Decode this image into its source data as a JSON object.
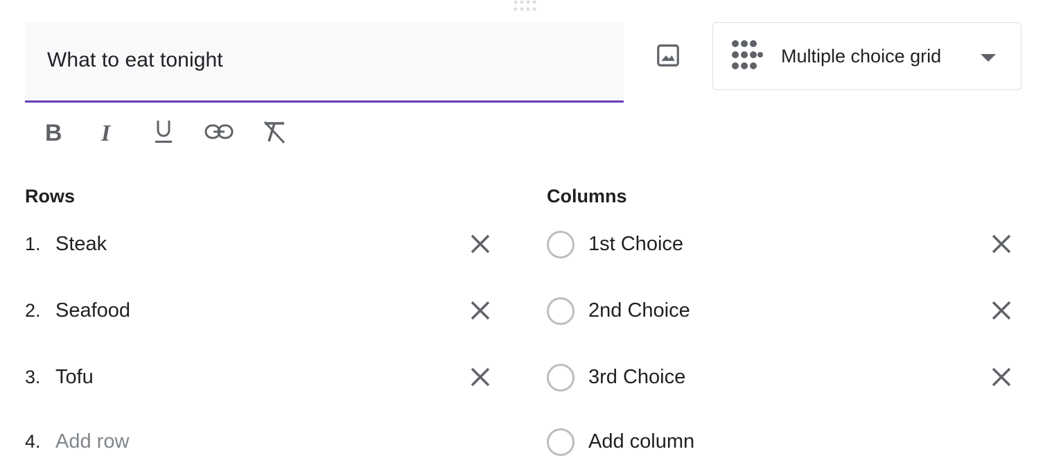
{
  "question": {
    "title": "What to eat tonight",
    "type": "Multiple choice grid"
  },
  "icons": {
    "drag": "drag-handle-icon",
    "image": "image-icon",
    "grid": "grid-dots-icon",
    "dropdown": "chevron-down-icon",
    "remove": "close-icon",
    "bold": "bold-icon",
    "italic": "italic-icon",
    "underline": "underline-icon",
    "link": "link-icon",
    "clear": "clear-formatting-icon"
  },
  "colors": {
    "accent": "#673ab7",
    "field_bg": "#f8f9fa",
    "icon": "#5f6368"
  },
  "rows": {
    "heading": "Rows",
    "items": [
      {
        "num": "1.",
        "label": "Steak"
      },
      {
        "num": "2.",
        "label": "Seafood"
      },
      {
        "num": "3.",
        "label": "Tofu"
      }
    ],
    "add": {
      "num": "4.",
      "label": "Add row"
    }
  },
  "columns": {
    "heading": "Columns",
    "items": [
      {
        "label": "1st Choice"
      },
      {
        "label": "2nd Choice"
      },
      {
        "label": "3rd Choice"
      }
    ],
    "add": {
      "label": "Add column"
    }
  }
}
